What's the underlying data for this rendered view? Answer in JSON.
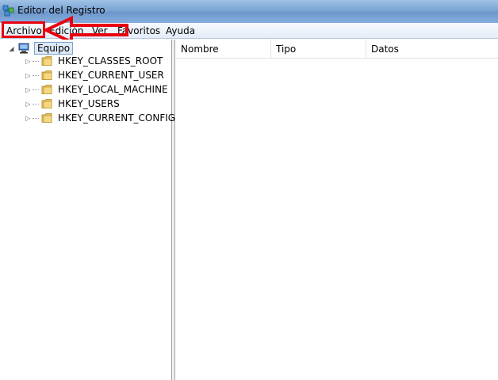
{
  "window": {
    "title": "Editor del Registro",
    "app_icon": "registry-editor-icon"
  },
  "menu": {
    "items": [
      "Archivo",
      "Edición",
      "Ver",
      "Favoritos",
      "Ayuda"
    ]
  },
  "annotation": {
    "highlighted_item": "Archivo",
    "color": "#e8000f"
  },
  "tree": {
    "root": "Equipo",
    "root_icon": "computer-icon",
    "children": [
      "HKEY_CLASSES_ROOT",
      "HKEY_CURRENT_USER",
      "HKEY_LOCAL_MACHINE",
      "HKEY_USERS",
      "HKEY_CURRENT_CONFIG"
    ],
    "child_icon": "folder-icon"
  },
  "list": {
    "columns": [
      "Nombre",
      "Tipo",
      "Datos"
    ]
  }
}
